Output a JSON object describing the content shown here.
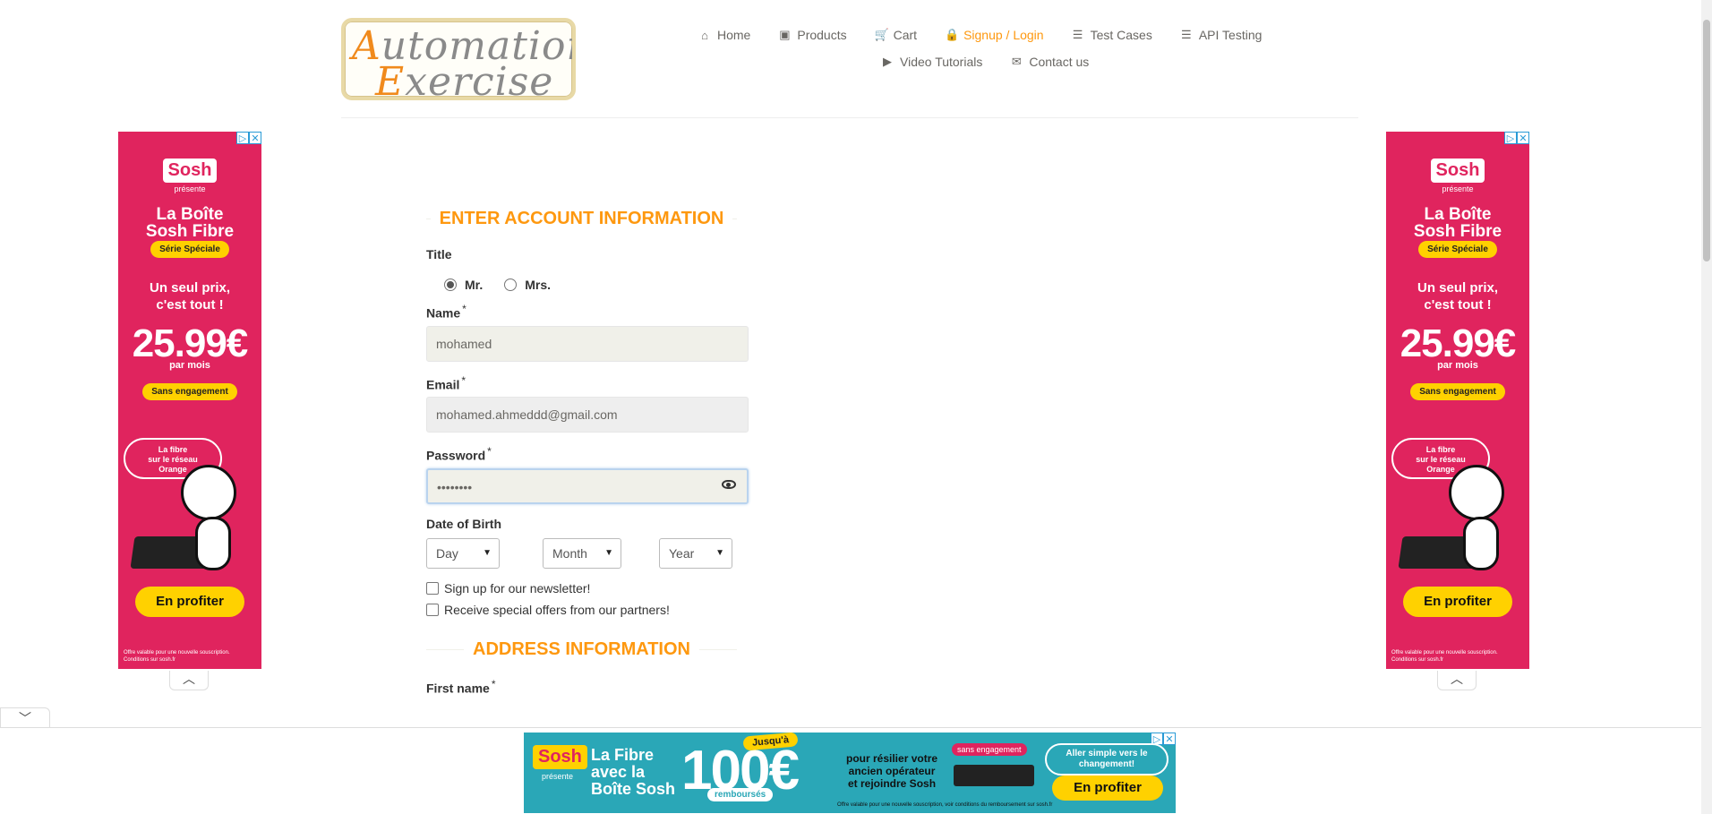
{
  "header": {
    "logo_text_1": "Automation",
    "logo_text_2": "Exercise",
    "nav": [
      {
        "label": "Home",
        "icon": "home-icon",
        "glyph": "⌂"
      },
      {
        "label": "Products",
        "icon": "products-icon",
        "glyph": "▣"
      },
      {
        "label": "Cart",
        "icon": "cart-icon",
        "glyph": "🛒"
      },
      {
        "label": "Signup / Login",
        "icon": "lock-icon",
        "glyph": "🔒",
        "active": true
      },
      {
        "label": "Test Cases",
        "icon": "list-icon",
        "glyph": "☰"
      },
      {
        "label": "API Testing",
        "icon": "list-icon",
        "glyph": "☰"
      },
      {
        "label": "Video Tutorials",
        "icon": "youtube-icon",
        "glyph": "▶"
      },
      {
        "label": "Contact us",
        "icon": "envelope-icon",
        "glyph": "✉"
      }
    ]
  },
  "form": {
    "account_title": "ENTER ACCOUNT INFORMATION",
    "title_label": "Title",
    "title_options": [
      "Mr.",
      "Mrs."
    ],
    "title_selected": "Mr.",
    "name_label": "Name",
    "name_value": "mohamed",
    "email_label": "Email",
    "email_value": "mohamed.ahmeddd@gmail.com",
    "password_label": "Password",
    "password_value": "••••••••",
    "dob_label": "Date of Birth",
    "dob_day": "Day",
    "dob_month": "Month",
    "dob_year": "Year",
    "newsletter_label": "Sign up for our newsletter!",
    "offers_label": "Receive special offers from our partners!",
    "address_title": "ADDRESS INFORMATION",
    "first_name_label": "First name",
    "required_mark": "*"
  },
  "side_ad": {
    "brand": "Sosh",
    "presents": "présente",
    "title_1": "La Boîte",
    "title_2": "Sosh Fibre",
    "badge": "Série Spéciale",
    "prix_1": "Un seul prix,",
    "prix_2": "c'est tout !",
    "price": "25.99€",
    "par_mois": "par mois",
    "engagement": "Sans engagement",
    "fibre_1": "La fibre",
    "fibre_2": "sur le réseau",
    "fibre_3": "Orange",
    "cta": "En profiter",
    "fine_1": "Offre valable pour une nouvelle souscription.",
    "fine_2": "Conditions sur sosh.fr"
  },
  "bottom_ad": {
    "brand": "Sosh",
    "presents": "présente",
    "title_1": "La Fibre",
    "title_2": "avec la",
    "title_3": "Boîte Sosh",
    "jusqua": "Jusqu'à",
    "amount": "100€",
    "rembourses": "remboursés",
    "text_1": "pour résilier votre",
    "text_2": "ancien opérateur",
    "text_3": "et rejoindre Sosh",
    "sans": "sans engagement",
    "aller_1": "Aller simple vers le",
    "aller_2": "changement!",
    "cta": "En profiter",
    "fine": "Offre valable pour une nouvelle souscription, voir conditions du remboursement sur sosh.fr"
  },
  "colors": {
    "accent": "#fe980f",
    "ad_pink": "#e0245e",
    "ad_teal": "#2aa7b7",
    "ad_yellow": "#ffd100"
  }
}
